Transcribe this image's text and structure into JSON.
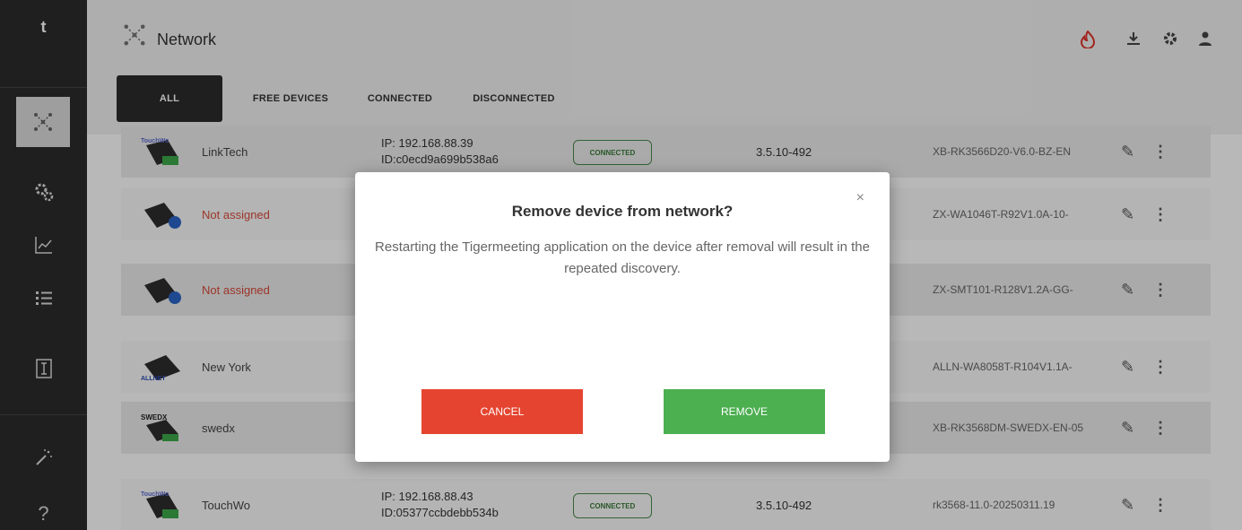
{
  "sidebar": {
    "logo": "t",
    "items": [
      {
        "icon": "network-icon",
        "glyph": "⁂"
      },
      {
        "icon": "settings-icon",
        "glyph": "⚙"
      },
      {
        "icon": "chart-icon",
        "glyph": "📈"
      },
      {
        "icon": "list-icon",
        "glyph": "☰"
      },
      {
        "icon": "document-icon",
        "glyph": "▤"
      },
      {
        "icon": "wand-icon",
        "glyph": "✨"
      },
      {
        "icon": "help-icon",
        "glyph": "?"
      }
    ]
  },
  "header": {
    "title": "Network",
    "icons": [
      "fire-icon",
      "download-icon",
      "settings-icon",
      "user-icon"
    ]
  },
  "tabs": [
    "ALL",
    "FREE DEVICES",
    "CONNECTED",
    "DISCONNECTED"
  ],
  "devices": [
    {
      "name": "LinkTech",
      "ip": "IP: 192.168.88.39",
      "id": "ID:c0ecd9a699b538a6",
      "status": "CONNECTED",
      "version": "3.5.10-492",
      "hw": "XB-RK3566D20-V6.0-BZ-EN"
    },
    {
      "name": "Not assigned",
      "ip": "",
      "id": "",
      "status": "",
      "version": "",
      "hw": "ZX-WA1046T-R92V1.0A-10-"
    },
    {
      "name": "Not assigned",
      "ip": "",
      "id": "",
      "status": "",
      "version": "",
      "hw": "ZX-SMT101-R128V1.2A-GG-"
    },
    {
      "name": "New York",
      "ip": "",
      "id": "",
      "status": "",
      "version": "",
      "hw": "ALLN-WA8058T-R104V1.1A-"
    },
    {
      "name": "swedx",
      "ip": "",
      "id": "",
      "status": "",
      "version": "",
      "hw": "XB-RK3568DM-SWEDX-EN-05"
    },
    {
      "name": "TouchWo",
      "ip": "IP: 192.168.88.43",
      "id": "ID:05377ccbdebb534b",
      "status": "CONNECTED",
      "version": "3.5.10-492",
      "hw": "rk3568-11.0-20250311.19"
    }
  ],
  "dialog": {
    "title": "Remove device from network?",
    "message": "Restarting the Tigermeeting application on the device after removal will result in the repeated discovery.",
    "cancel_label": "CANCEL",
    "remove_label": "REMOVE",
    "close_glyph": "×"
  },
  "colors": {
    "sidebar": "#2b2b2b",
    "cancel": "#e54530",
    "remove": "#4caf50",
    "connected": "#3a7a3a",
    "unassigned": "#d84a3a"
  }
}
